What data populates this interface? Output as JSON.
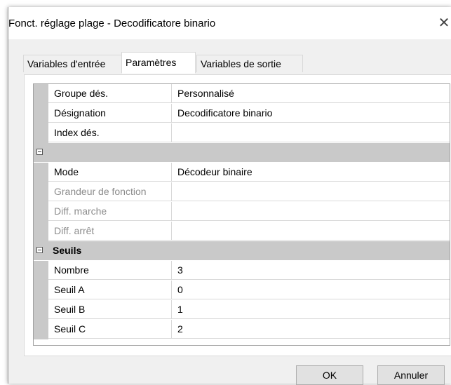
{
  "window": {
    "title": "Fonct. réglage plage - Decodificatore binario",
    "close_label": "✕"
  },
  "tabs": [
    {
      "label": "Variables d'entrée",
      "active": false
    },
    {
      "label": "Paramètres",
      "active": true
    },
    {
      "label": "Variables de sortie",
      "active": false
    }
  ],
  "grid": {
    "general": [
      {
        "name": "Groupe dés.",
        "value": "Personnalisé"
      },
      {
        "name": "Désignation",
        "value": "Decodificatore binario"
      },
      {
        "name": "Index dés.",
        "value": ""
      }
    ],
    "mode_category_label": "",
    "mode_rows": [
      {
        "name": "Mode",
        "value": "Décodeur binaire",
        "enabled": true
      },
      {
        "name": "Grandeur de fonction",
        "value": "",
        "enabled": false
      },
      {
        "name": "Diff. marche",
        "value": "",
        "enabled": false
      },
      {
        "name": "Diff. arrêt",
        "value": "",
        "enabled": false
      }
    ],
    "seuils_category_label": "Seuils",
    "seuils_rows": [
      {
        "name": "Nombre",
        "value": "3"
      },
      {
        "name": "Seuil A",
        "value": "0"
      },
      {
        "name": "Seuil B",
        "value": "1"
      },
      {
        "name": "Seuil C",
        "value": "2"
      }
    ]
  },
  "buttons": {
    "ok": "OK",
    "cancel": "Annuler"
  },
  "colors": {
    "dialog_bg": "#f0f0f0",
    "category_bg": "#c9c9c9",
    "disabled_text": "#8c8c8c"
  },
  "icons": {
    "close": "close-icon",
    "collapse": "collapse-minus-icon"
  }
}
